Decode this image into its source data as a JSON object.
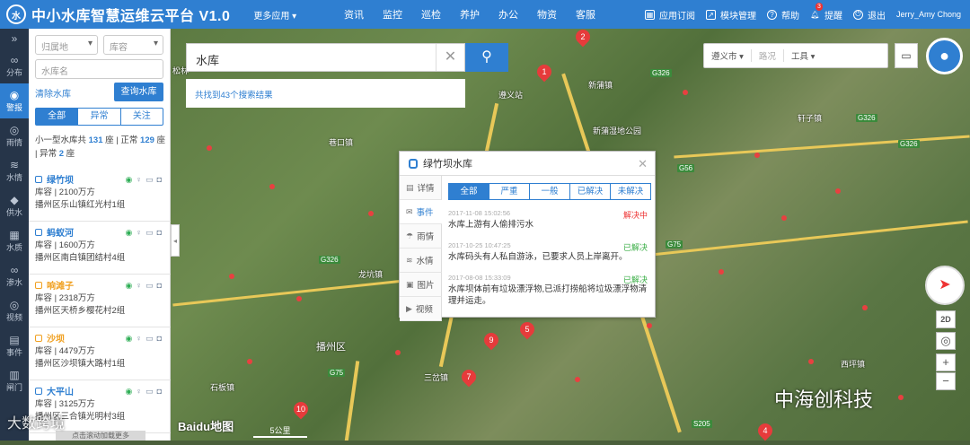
{
  "app": {
    "logo_text": "水",
    "title": "中小水库智慧运维云平台 V1.0",
    "more_apps": "更多应用 ▾"
  },
  "nav": [
    "资讯",
    "监控",
    "巡检",
    "养护",
    "办公",
    "物资",
    "客服"
  ],
  "top_tools": [
    {
      "label": "应用订阅",
      "icon": "grid-icon"
    },
    {
      "label": "模块管理",
      "icon": "module-icon"
    },
    {
      "label": "帮助",
      "icon": "help-icon"
    },
    {
      "label": "提醒",
      "icon": "bell-icon",
      "badge": "3"
    },
    {
      "label": "退出",
      "icon": "power-icon"
    }
  ],
  "user": "Jerry_Amy Chong",
  "left_nav": [
    {
      "glyph": "»",
      "label": ""
    },
    {
      "glyph": "∞",
      "label": "分布"
    },
    {
      "glyph": "◉",
      "label": "警报",
      "active": true
    },
    {
      "glyph": "◎",
      "label": "雨情"
    },
    {
      "glyph": "≋",
      "label": "水情"
    },
    {
      "glyph": "◆",
      "label": "供水"
    },
    {
      "glyph": "▦",
      "label": "水质"
    },
    {
      "glyph": "∞",
      "label": "渗水"
    },
    {
      "glyph": "◎",
      "label": "视频"
    },
    {
      "glyph": "▤",
      "label": "事件"
    },
    {
      "glyph": "▥",
      "label": "闸门"
    }
  ],
  "filters": {
    "region": "归属地",
    "capacity": "库容",
    "name_placeholder": "水库名"
  },
  "clear_link": "清除水库",
  "query_button": "查询水库",
  "status_tabs": [
    "全部",
    "异常",
    "关注"
  ],
  "summary": {
    "prefix": "小一型水库共 ",
    "total": "131",
    "mid1": " 座 | 正常 ",
    "normal": "129",
    "mid2": " 座 | 异常 ",
    "abnormal": "2",
    "suffix": " 座"
  },
  "reservoirs": [
    {
      "name": "绿竹坝",
      "capacity": "库容 | 2100万方",
      "location": "播州区乐山镇红光村1组",
      "warn": false
    },
    {
      "name": "蚂蚁河",
      "capacity": "库容 | 1600万方",
      "location": "播州区南白镇团结村4组",
      "warn": false
    },
    {
      "name": "响滩子",
      "capacity": "库容 | 2318万方",
      "location": "播州区天桥乡樱花村2组",
      "warn": true
    },
    {
      "name": "沙坝",
      "capacity": "库容 | 4479万方",
      "location": "播州区沙坝镇大路村1组",
      "warn": true
    },
    {
      "name": "大平山",
      "capacity": "库容 | 3125万方",
      "location": "播州区三合镇光明村3组",
      "warn": false
    }
  ],
  "bottom_tip": "点击滚动加载更多",
  "search": {
    "value": "水库",
    "result": "共找到43个搜索结果"
  },
  "map_tools": {
    "city": "遵义市 ▾",
    "traffic": "路况",
    "tools": "工具 ▾"
  },
  "popup": {
    "title": "绿竹坝水库",
    "tabs": [
      {
        "icon": "▤",
        "label": "详情"
      },
      {
        "icon": "✉",
        "label": "事件",
        "active": true
      },
      {
        "icon": "☂",
        "label": "雨情"
      },
      {
        "icon": "≋",
        "label": "水情"
      },
      {
        "icon": "▣",
        "label": "图片"
      },
      {
        "icon": "▶",
        "label": "视频"
      }
    ],
    "filters": [
      "全部",
      "严重",
      "一般",
      "已解决",
      "未解决"
    ],
    "events": [
      {
        "time": "2017-11-08 15:02:56",
        "status": "解决中",
        "status_color": "red",
        "desc": "水库上游有人偷排污水"
      },
      {
        "time": "2017-10-25 10:47:25",
        "status": "已解决",
        "status_color": "grn",
        "desc": "水库码头有人私自游泳，已要求人员上岸离开。"
      },
      {
        "time": "2017-08-08 15:33:09",
        "status": "已解决",
        "status_color": "grn",
        "desc": "水库坝体前有垃圾漂浮物,已派打捞船将垃圾漂浮物清理并运走。"
      }
    ]
  },
  "map_labels": {
    "places": [
      "遵义站",
      "新蒲镇",
      "新蒲湿地公园",
      "巷口镇",
      "龙坑镇",
      "播州区",
      "三岔镇",
      "石板镇",
      "西坪镇",
      "轩子镇",
      "松林"
    ],
    "roads": [
      "G326",
      "G326",
      "G326",
      "G56",
      "G75",
      "G326",
      "G75",
      "S205"
    ],
    "pins": [
      "1",
      "2",
      "4",
      "5",
      "7",
      "9",
      "10"
    ]
  },
  "map_controls": {
    "mode": "2D",
    "zoom_in": "+",
    "zoom_out": "−",
    "scale": "5公里",
    "logo": "Baidu地图"
  },
  "watermark": "中海创科技",
  "corner_mark": "大数跨境"
}
